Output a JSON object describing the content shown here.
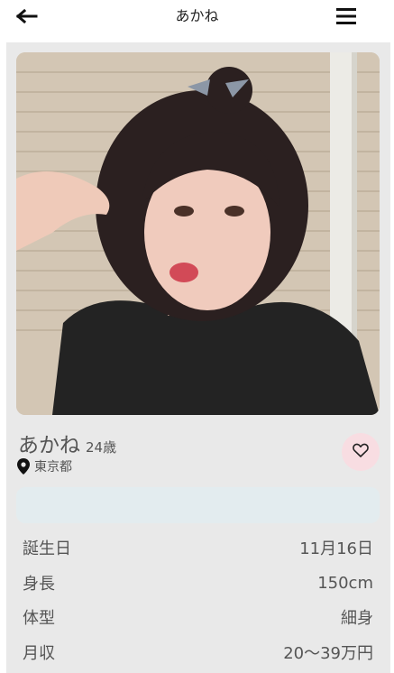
{
  "header": {
    "title": "あかね",
    "back_icon": "back-arrow-icon",
    "menu_icon": "hamburger-menu-icon"
  },
  "profile": {
    "name": "あかね",
    "age": "24歳",
    "location": "東京都",
    "location_icon": "map-pin-icon",
    "like_icon": "heart-icon",
    "like_button_color": "#f8dde2",
    "message": ""
  },
  "details": [
    {
      "label": "誕生日",
      "value": "11月16日"
    },
    {
      "label": "身長",
      "value": "150cm"
    },
    {
      "label": "体型",
      "value": "細身"
    },
    {
      "label": "月収",
      "value": "20〜39万円"
    }
  ]
}
